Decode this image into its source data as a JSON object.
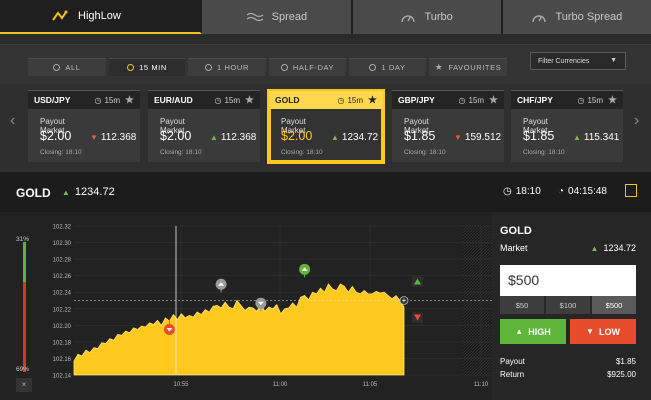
{
  "top_tabs": [
    {
      "label": "HighLow",
      "icon": "highlow-icon",
      "active": true
    },
    {
      "label": "Spread",
      "icon": "spread-icon",
      "active": false
    },
    {
      "label": "Turbo",
      "icon": "turbo-gauge-icon",
      "active": false
    },
    {
      "label": "Turbo Spread",
      "icon": "turbo-spread-gauge-icon",
      "active": false
    }
  ],
  "periods": [
    {
      "label": "ALL",
      "active": false
    },
    {
      "label": "15 MIN",
      "active": true
    },
    {
      "label": "1 HOUR",
      "active": false
    },
    {
      "label": "HALF-DAY",
      "active": false
    },
    {
      "label": "1 DAY",
      "active": false
    },
    {
      "label": "FAVOURITES",
      "active": false
    }
  ],
  "filter_label": "Filter Currencies",
  "assets": [
    {
      "name": "USD/JPY",
      "time": "15m",
      "payout_label": "Payout",
      "market_label": "Market",
      "payout": "$2.00",
      "market": "112.368",
      "direction": "down",
      "closing": "Closing: 18:10"
    },
    {
      "name": "EUR/AUD",
      "time": "15m",
      "payout_label": "Payout",
      "market_label": "Market",
      "payout": "$2.00",
      "market": "112.368",
      "direction": "up",
      "closing": "Closing: 18:10"
    },
    {
      "name": "GOLD",
      "time": "15m",
      "payout_label": "Payout",
      "market_label": "Market",
      "payout": "$2.00",
      "market": "1234.72",
      "direction": "up",
      "closing": "Closing: 18:10",
      "selected": true
    },
    {
      "name": "GBP/JPY",
      "time": "15m",
      "payout_label": "Payout",
      "market_label": "Market",
      "payout": "$1.85",
      "market": "159.512",
      "direction": "down",
      "closing": "Closing: 18:10"
    },
    {
      "name": "CHF/JPY",
      "time": "15m",
      "payout_label": "Payout",
      "market_label": "Market",
      "payout": "$1.85",
      "market": "115.341",
      "direction": "up",
      "closing": "Closing: 18:10"
    }
  ],
  "asset_bar": {
    "name": "GOLD",
    "price": "1234.72",
    "closing_time": "18:10",
    "countdown": "04:15:48"
  },
  "sentiment": {
    "high": "31%",
    "low": "69%",
    "high_fraction": 0.31,
    "close": "×"
  },
  "chart_data": {
    "type": "area",
    "y_ticks": [
      "102.32",
      "102.30",
      "102.28",
      "102.26",
      "102.24",
      "102.22",
      "102.20",
      "102.18",
      "102.16",
      "102.14"
    ],
    "x_ticks": [
      "10:55",
      "11:00",
      "11:05",
      "11:10"
    ],
    "ylim": [
      102.14,
      102.32
    ],
    "current_level": 102.23,
    "series": [
      {
        "values": [
          102.157,
          102.165,
          102.163,
          102.17,
          102.167,
          102.173,
          102.172,
          102.179,
          102.178,
          102.184,
          102.182,
          102.189,
          102.188,
          102.193,
          102.191,
          102.197,
          102.195,
          102.199,
          102.198,
          102.203,
          102.201,
          102.206,
          102.2,
          102.209,
          102.205,
          102.213,
          102.207,
          102.214,
          102.209,
          102.212,
          102.21,
          102.216,
          102.213,
          102.219,
          102.216,
          102.223,
          102.224,
          102.221,
          102.228,
          102.222,
          102.22,
          102.23,
          102.224,
          102.218,
          102.222,
          102.221,
          102.217,
          102.225,
          102.217,
          102.222,
          102.22,
          102.225,
          102.214,
          102.22,
          102.221,
          102.227,
          102.222,
          102.234,
          102.236,
          102.231,
          102.24,
          102.238,
          102.245,
          102.24,
          102.25,
          102.244,
          102.242,
          102.25,
          102.247,
          102.24,
          102.247,
          102.24,
          102.238,
          102.242,
          102.238,
          102.238,
          102.241,
          102.239,
          102.24,
          102.236,
          102.232,
          102.236,
          102.23,
          102.222
        ]
      }
    ],
    "markers": [
      {
        "type": "low",
        "index": 24,
        "value": 102.207
      },
      {
        "type": "up",
        "index": 37,
        "value": 102.24
      },
      {
        "type": "down",
        "index": 47,
        "value": 102.217
      },
      {
        "type": "up",
        "index": 58,
        "value": 102.258
      }
    ]
  },
  "panel": {
    "title": "GOLD",
    "market_label": "Market",
    "market_value": "1234.72",
    "amount": "$500",
    "chips": [
      "$50",
      "$100",
      "$500"
    ],
    "active_chip": 2,
    "high_label": "HIGH",
    "low_label": "LOW",
    "payout_label": "Payout",
    "payout_value": "$1.85",
    "return_label": "Return",
    "return_value": "$925.00"
  },
  "colors": {
    "accent": "#f5c21b",
    "up": "#5fb43a",
    "down": "#e74d2d",
    "area": "#ffc91f"
  }
}
